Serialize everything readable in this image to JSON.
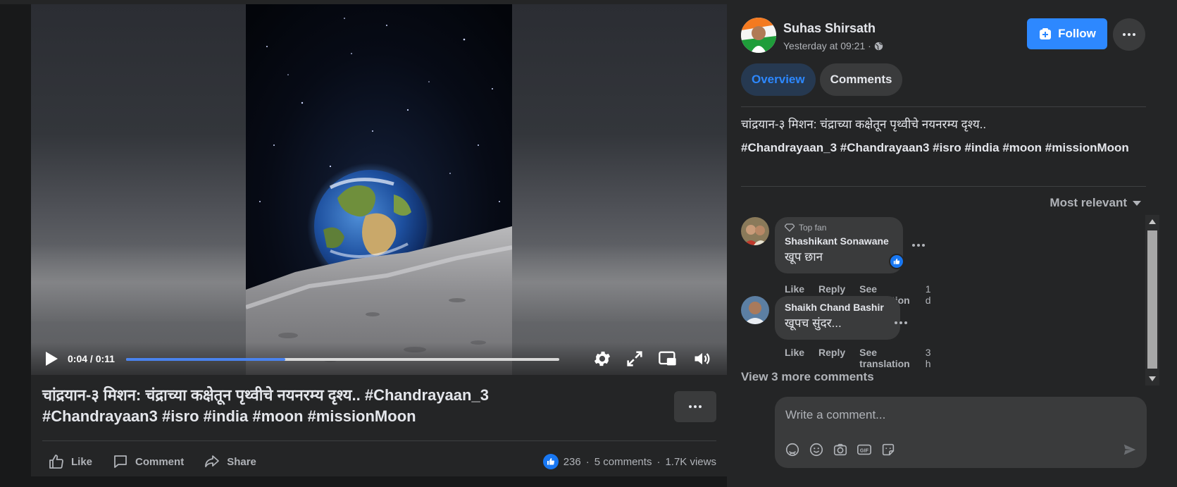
{
  "video": {
    "time_display": "0:04 / 0:11",
    "progress_fraction": 0.367,
    "icons": [
      "play-icon",
      "settings-gear-icon",
      "fullscreen-icon",
      "picture-in-picture-icon",
      "volume-icon"
    ]
  },
  "post": {
    "title_line1": "चांद्रयान-३ मिशन: चंद्राच्या कक्षेतून पृथ्वीचे नयनरम्य दृश्य.. #Chandrayaan_3",
    "title_line2": "#Chandrayaan3 #isro #india #moon #missionMoon",
    "actions": {
      "like": "Like",
      "comment": "Comment",
      "share": "Share"
    },
    "stats": {
      "reactions": "236",
      "comments": "5 comments",
      "views": "1.7K views"
    }
  },
  "sidebar": {
    "author": "Suhas Shirsath",
    "timestamp": "Yesterday at 09:21 ·",
    "follow_label": "Follow",
    "tabs": [
      {
        "label": "Overview",
        "active": true
      },
      {
        "label": "Comments",
        "active": false
      }
    ],
    "description": "चांद्रयान-३ मिशन: चंद्राच्या कक्षेतून पृथ्वीचे नयनरम्य दृश्य..",
    "hashtags": "#Chandrayaan_3 #Chandrayaan3 #isro #india #moon #missionMoon",
    "sort_label": "Most relevant",
    "comments": [
      {
        "badge": "Top fan",
        "name": "Shashikant Sonawane",
        "text": "खूप छान",
        "has_like_reaction": true,
        "like": "Like",
        "reply": "Reply",
        "see_translation": "See translation",
        "age": "1 d"
      },
      {
        "badge": "",
        "name": "Shaikh Chand Bashir",
        "text": "खूपच सुंदर...",
        "has_like_reaction": false,
        "like": "Like",
        "reply": "Reply",
        "see_translation": "See translation",
        "age": "3 h"
      }
    ],
    "view_more": "View 3 more comments",
    "composer_placeholder": "Write a comment...",
    "composer_tools": [
      "avatar-sticker-icon",
      "emoji-icon",
      "camera-icon",
      "gif-icon",
      "sticker-icon"
    ]
  },
  "colors": {
    "accent": "#2d88ff",
    "background": "#18191a",
    "panel": "#242526",
    "bubble": "#3a3b3c",
    "progress": "#4a83ee"
  }
}
